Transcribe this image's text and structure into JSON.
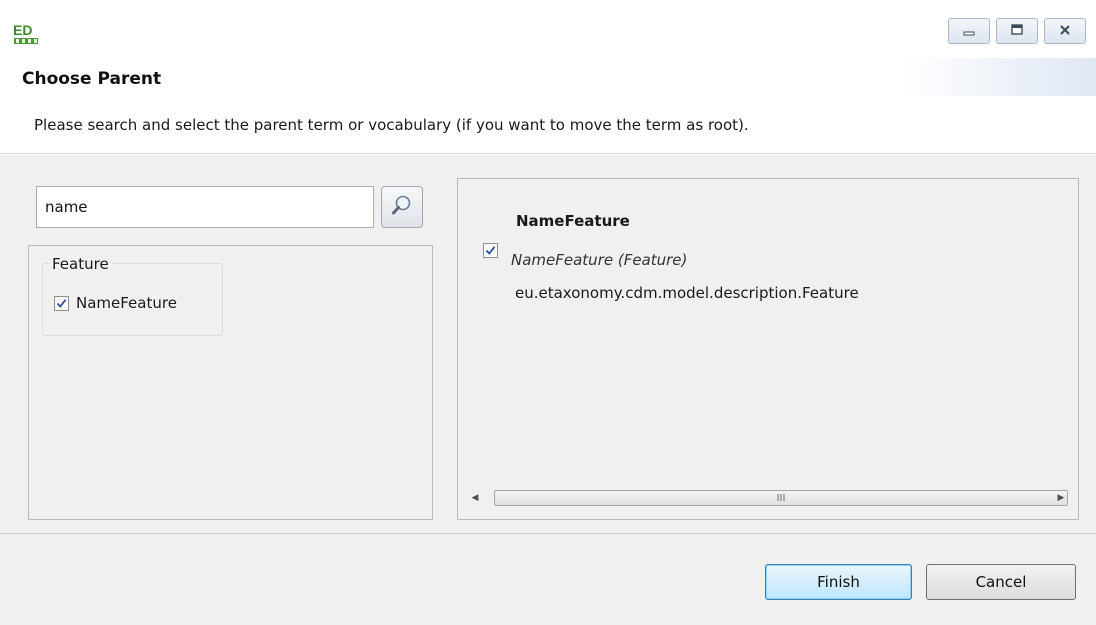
{
  "window": {
    "icon": "app-ed-icon",
    "controls": [
      "minimize-icon",
      "maximize-icon",
      "close-icon"
    ]
  },
  "header": {
    "title": "Choose Parent",
    "description": "Please search and select the parent term or vocabulary (if you want to move the term as root)."
  },
  "search": {
    "value": "name",
    "button_icon": "magnifier-icon"
  },
  "results": {
    "group_label": "Feature",
    "items": [
      {
        "label": "NameFeature",
        "checked": true
      }
    ]
  },
  "detail": {
    "title": "NameFeature",
    "type_label": "NameFeature (Feature)",
    "type_checked": true,
    "class_name": "eu.etaxonomy.cdm.model.description.Feature",
    "scroll_grip": "III"
  },
  "footer": {
    "finish_label": "Finish",
    "cancel_label": "Cancel"
  },
  "colors": {
    "dialog_bg": "#f0f0f0",
    "finish_border": "#3c7fb1",
    "checkmark": "#2f4f9e"
  }
}
